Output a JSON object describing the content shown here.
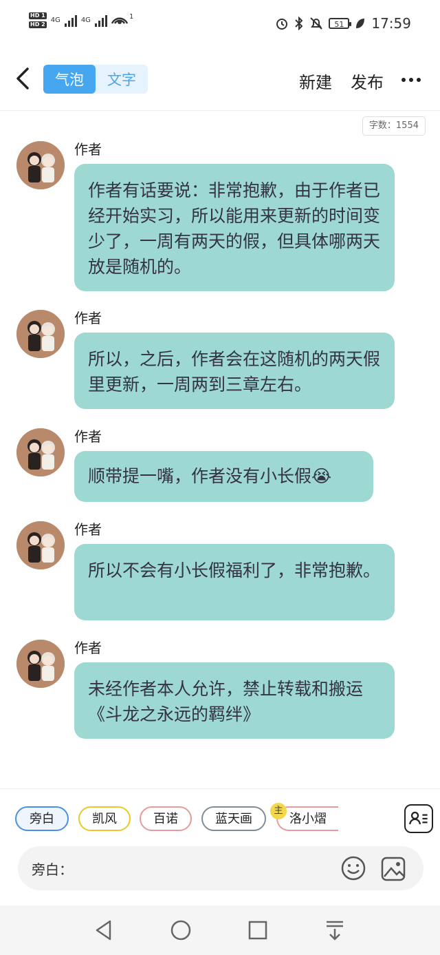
{
  "status_bar": {
    "hd1": "HD 1",
    "hd2": "HD 2",
    "net1": "4G",
    "net2": "4G",
    "hotspot_count": "1",
    "battery": "51",
    "time": "17:59"
  },
  "header": {
    "tabs": [
      {
        "label": "气泡",
        "active": true
      },
      {
        "label": "文字",
        "active": false
      }
    ],
    "new_label": "新建",
    "publish_label": "发布"
  },
  "word_count": "字数：1554",
  "messages": [
    {
      "author": "作者",
      "text": "作者有话要说：非常抱歉，由于作者已经开始实习，所以能用来更新的时间变少了，一周有两天的假，但具体哪两天放是随机的。"
    },
    {
      "author": "作者",
      "text": "所以，之后，作者会在这随机的两天假里更新，一周两到三章左右。"
    },
    {
      "author": "作者",
      "text": "顺带提一嘴，作者没有小长假😭"
    },
    {
      "author": "作者",
      "text": "所以不会有小长假福利了，非常抱歉。"
    },
    {
      "author": "作者",
      "text": "未经作者本人允许，禁止转载和搬运《斗龙之永远的羁绊》"
    }
  ],
  "roles": [
    {
      "label": "旁白",
      "color": "#4a90e2",
      "selected": true
    },
    {
      "label": "凯风",
      "color": "#e8c92c",
      "selected": false
    },
    {
      "label": "百诺",
      "color": "#e89a9a",
      "selected": false
    },
    {
      "label": "蓝天画",
      "color": "#7f8c96",
      "selected": false
    },
    {
      "label": "洛小熠",
      "color": "#e89a9a",
      "selected": false,
      "main_badge": "主"
    }
  ],
  "input": {
    "label": "旁白："
  },
  "colors": {
    "accent": "#47a6f0",
    "bubble": "#9ed8d2"
  }
}
